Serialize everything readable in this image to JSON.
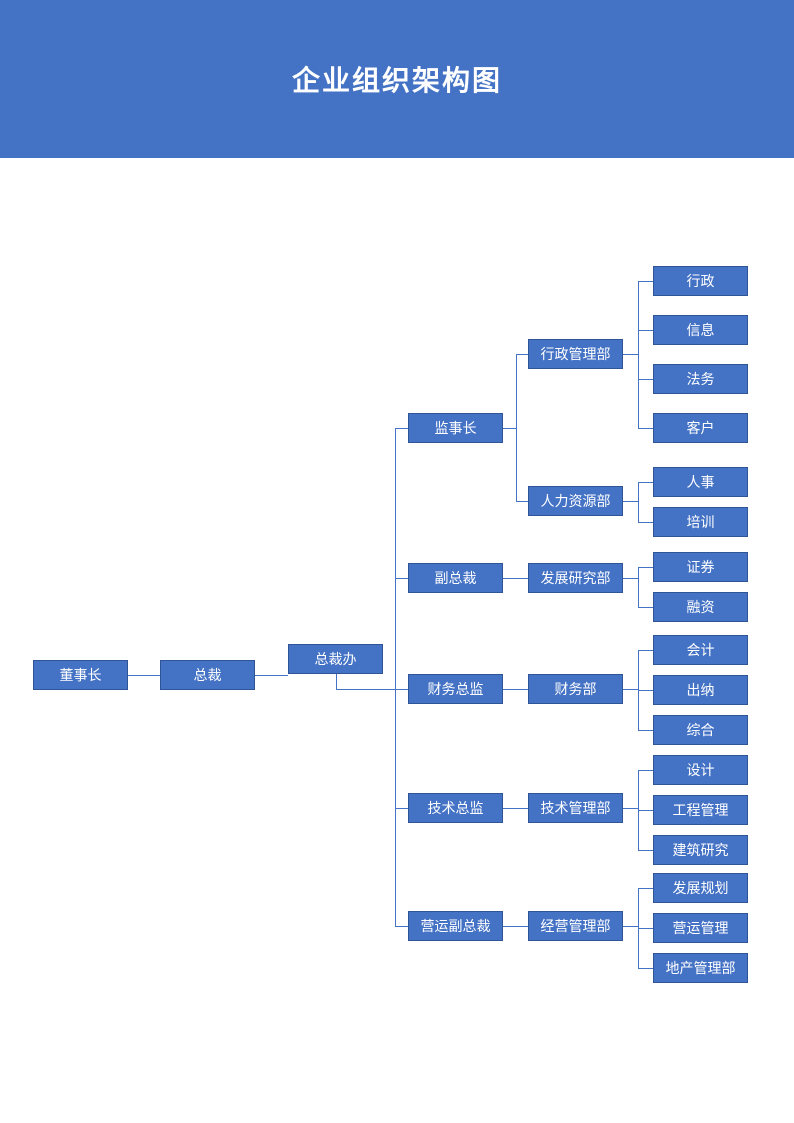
{
  "header": {
    "title": "企业组织架构图"
  },
  "colors": {
    "primary": "#4472c4",
    "border": "#2f5597",
    "text": "#ffffff"
  },
  "nodes": {
    "chairman": "董事长",
    "president": "总裁",
    "president_office": "总裁办",
    "supervisor": "监事长",
    "vice_president": "副总裁",
    "cfo": "财务总监",
    "cto": "技术总监",
    "coo": "营运副总裁",
    "admin_dept": "行政管理部",
    "hr_dept": "人力资源部",
    "rd_dept": "发展研究部",
    "finance_dept": "财务部",
    "tech_dept": "技术管理部",
    "ops_dept": "经营管理部",
    "administration": "行政",
    "information": "信息",
    "legal": "法务",
    "customer": "客户",
    "personnel": "人事",
    "training": "培训",
    "securities": "证券",
    "financing": "融资",
    "accounting": "会计",
    "cashier": "出纳",
    "general": "综合",
    "design": "设计",
    "engineering": "工程管理",
    "construction": "建筑研究",
    "dev_planning": "发展规划",
    "ops_mgmt": "营运管理",
    "real_estate": "地产管理部"
  }
}
